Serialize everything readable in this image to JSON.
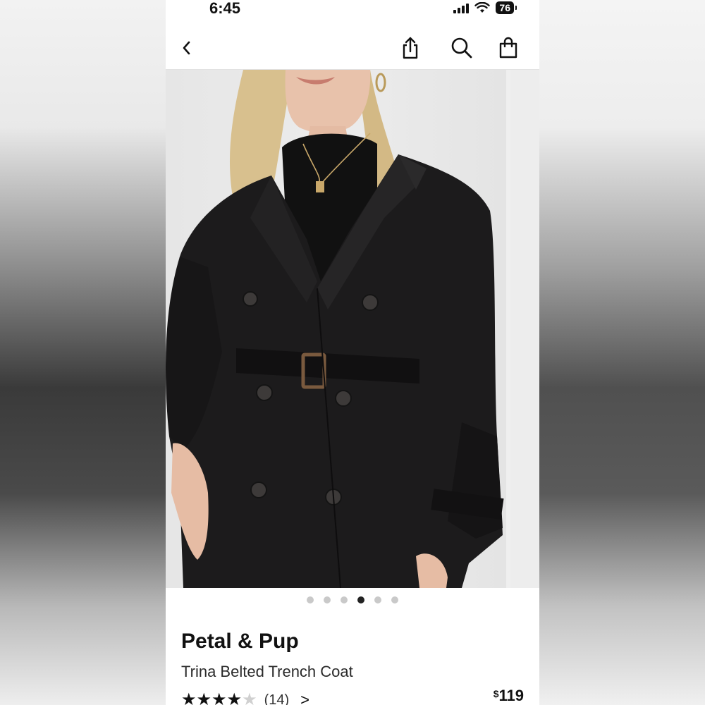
{
  "status_bar": {
    "time": "6:45",
    "battery": "76"
  },
  "nav": {
    "back_icon": "chevron-left-icon",
    "share_icon": "share-icon",
    "search_icon": "search-icon",
    "bag_icon": "shopping-bag-icon"
  },
  "gallery": {
    "image_count": 6,
    "active_index": 3
  },
  "product": {
    "brand": "Petal & Pup",
    "name": "Trina Belted Trench Coat",
    "rating": 4.5,
    "rating_count": "(14)",
    "rating_chevron": ">",
    "price_currency": "$",
    "price_amount": "119"
  },
  "colors": {
    "accent": "#111111",
    "dot_inactive": "#c9c9c9",
    "coat": "#1c1b1c"
  }
}
